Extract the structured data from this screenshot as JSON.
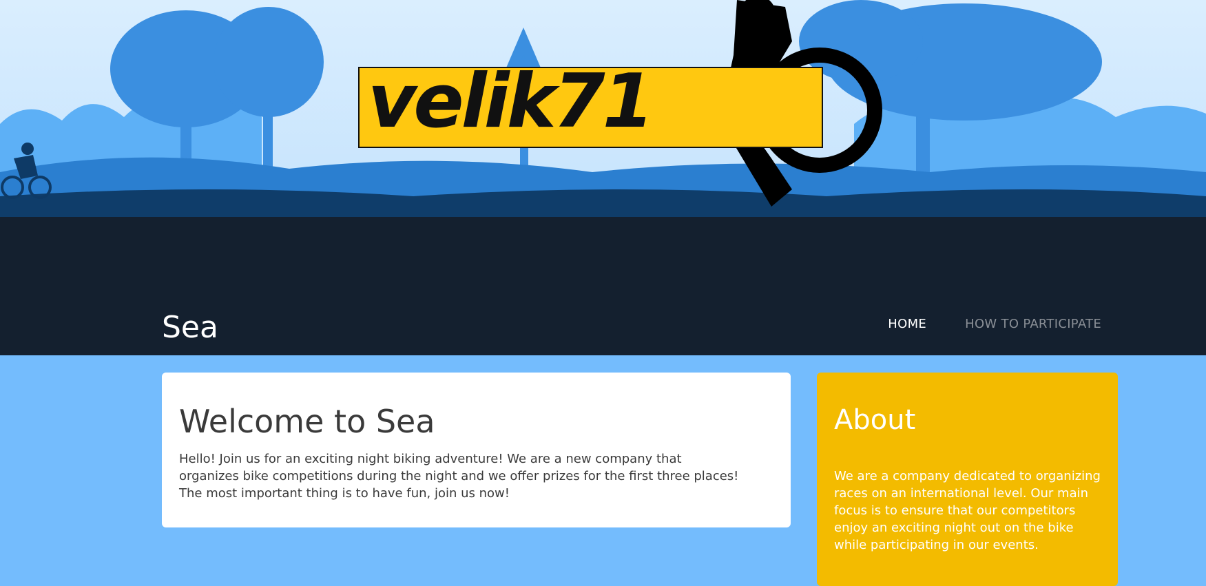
{
  "logo": {
    "text": "velik71"
  },
  "header": {
    "site_title": "Sea",
    "nav": [
      {
        "label": "HOME",
        "active": true
      },
      {
        "label": "HOW TO PARTICIPATE",
        "active": false
      }
    ]
  },
  "main": {
    "welcome_title": "Welcome to Sea",
    "welcome_text": "Hello! Join us for an exciting night biking adventure! We are a new company that organizes bike competitions during the night and we offer prizes for the first three places! The most important thing is to have fun, join us now!"
  },
  "sidebar": {
    "about_title": "About",
    "about_text": "We are a company dedicated to organizing races on an international level. Our main focus is to ensure that our competitors enjoy an exciting night out on the bike while participating in our events."
  },
  "colors": {
    "sky": "#daeefe",
    "dark_band": "#14202f",
    "page_background": "#74bcfd",
    "logo_yellow": "#ffc810",
    "about_card": "#f3bb00",
    "nav_active": "#ffffff",
    "nav_inactive": "#8a8f96"
  }
}
